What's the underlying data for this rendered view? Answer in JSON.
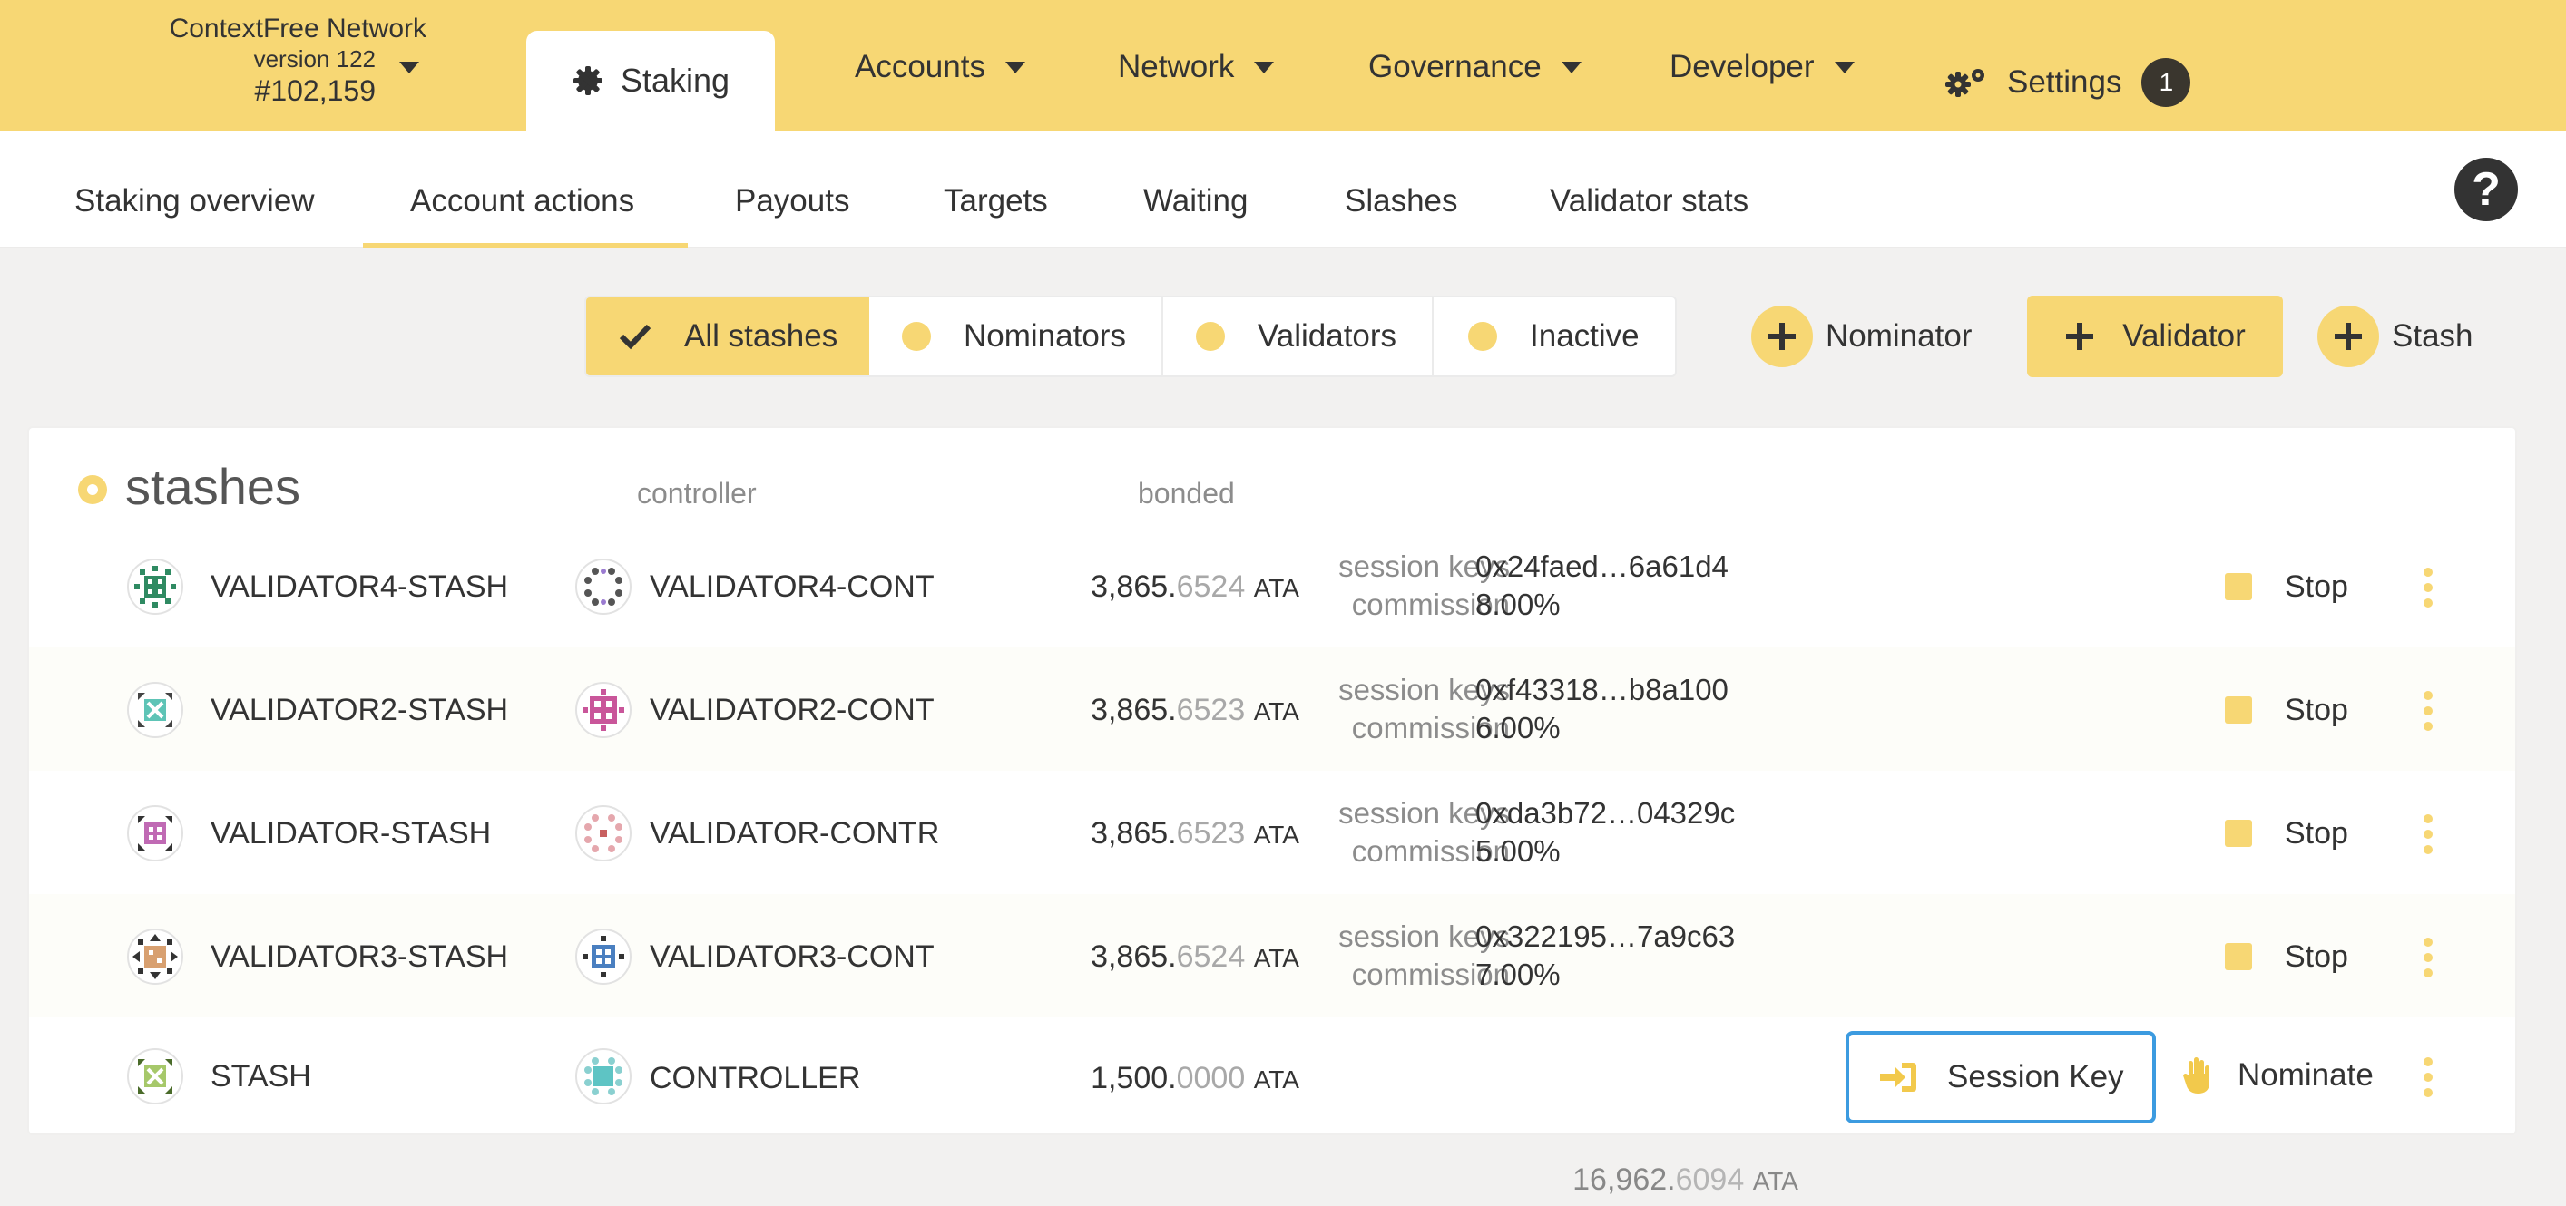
{
  "chain": {
    "name": "ContextFree Network",
    "version": "version 122",
    "block": "#102,159"
  },
  "nav": {
    "active_tab": "Staking",
    "menus": [
      "Accounts",
      "Network",
      "Governance",
      "Developer"
    ],
    "settings": "Settings",
    "settings_badge": "1"
  },
  "subnav": {
    "tabs": [
      "Staking overview",
      "Account actions",
      "Payouts",
      "Targets",
      "Waiting",
      "Slashes",
      "Validator stats"
    ],
    "active": "Account actions"
  },
  "filters": [
    "All stashes",
    "Nominators",
    "Validators",
    "Inactive"
  ],
  "filter_selected": "All stashes",
  "actions": {
    "nominator": "Nominator",
    "validator": "Validator",
    "stash": "Stash"
  },
  "table": {
    "title": "stashes",
    "col_controller": "controller",
    "col_bonded": "bonded",
    "rows": [
      {
        "stash": "VALIDATOR4-STASH",
        "controller": "VALIDATOR4-CONT",
        "bonded_int": "3,865.",
        "bonded_dec": "6524",
        "unit": "ATA",
        "session_label": "session keys",
        "session_value": "0x24faed…6a61d4",
        "commission_label": "commission",
        "commission_value": "8.00%",
        "action": "Stop"
      },
      {
        "stash": "VALIDATOR2-STASH",
        "controller": "VALIDATOR2-CONT",
        "bonded_int": "3,865.",
        "bonded_dec": "6523",
        "unit": "ATA",
        "session_label": "session keys",
        "session_value": "0xf43318…b8a100",
        "commission_label": "commission",
        "commission_value": "6.00%",
        "action": "Stop"
      },
      {
        "stash": "VALIDATOR-STASH",
        "controller": "VALIDATOR-CONTR",
        "bonded_int": "3,865.",
        "bonded_dec": "6523",
        "unit": "ATA",
        "session_label": "session keys",
        "session_value": "0xda3b72…04329c",
        "commission_label": "commission",
        "commission_value": "5.00%",
        "action": "Stop"
      },
      {
        "stash": "VALIDATOR3-STASH",
        "controller": "VALIDATOR3-CONT",
        "bonded_int": "3,865.",
        "bonded_dec": "6524",
        "unit": "ATA",
        "session_label": "session keys",
        "session_value": "0x322195…7a9c63",
        "commission_label": "commission",
        "commission_value": "7.00%",
        "action": "Stop"
      },
      {
        "stash": "STASH",
        "controller": "CONTROLLER",
        "bonded_int": "1,500.",
        "bonded_dec": "0000",
        "unit": "ATA",
        "session_button": "Session Key",
        "nominate_button": "Nominate"
      }
    ],
    "total_int": "16,962.",
    "total_dec": "6094",
    "total_unit": "ATA"
  },
  "colors": {
    "accent": "#f7d774",
    "focus": "#3c9be0",
    "dark": "#3a362e"
  },
  "icons": [
    "chevron-down-icon",
    "staking-gear-icon",
    "settings-gears-icon",
    "help-icon",
    "check-icon",
    "plus-icon",
    "account-identicon",
    "session-key-icon",
    "hand-icon",
    "kebab-icon"
  ]
}
